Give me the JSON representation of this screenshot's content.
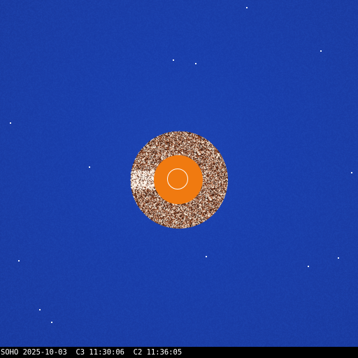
{
  "image": {
    "description_kind": "SOHO LASCO C2/C3 composite coronagraph frame",
    "colors": {
      "background": "#1b3ea8",
      "occulter": "#f07a10",
      "caption_bar": "#000000",
      "caption_text": "#ffffff",
      "sun_outline": "#ffffff"
    }
  },
  "caption": {
    "text": "SOHO 2025-10-03  C3 11:30:06  C2 11:36:05"
  }
}
